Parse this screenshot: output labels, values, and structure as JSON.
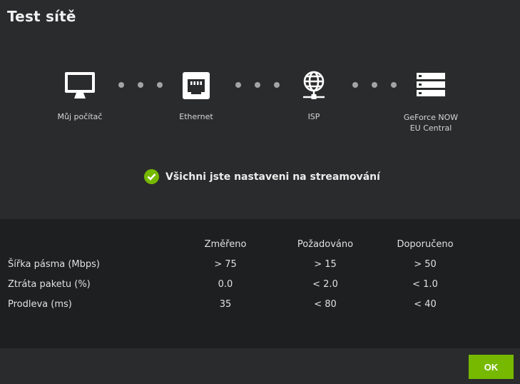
{
  "dialog": {
    "title": "Test sítě"
  },
  "path": {
    "nodes": [
      {
        "label": "Můj počítač",
        "label2": "",
        "icon": "monitor-icon"
      },
      {
        "label": "Ethernet",
        "label2": "",
        "icon": "ethernet-port-icon"
      },
      {
        "label": "ISP",
        "label2": "",
        "icon": "globe-network-icon"
      },
      {
        "label": "GeForce NOW",
        "label2": "EU Central",
        "icon": "server-rack-icon"
      }
    ]
  },
  "status": {
    "text": "Všichni jste nastaveni na streamování",
    "icon": "check-circle-icon",
    "color": "#76b900"
  },
  "results": {
    "headers": [
      "Změřeno",
      "Požadováno",
      "Doporučeno"
    ],
    "rows": [
      {
        "label": "Šířka pásma (Mbps)",
        "values": [
          "> 75",
          "> 15",
          "> 50"
        ]
      },
      {
        "label": "Ztráta paketu (%)",
        "values": [
          "0.0",
          "< 2.0",
          "< 1.0"
        ]
      },
      {
        "label": "Prodleva (ms)",
        "values": [
          "35",
          "< 80",
          "< 40"
        ]
      }
    ]
  },
  "footer": {
    "ok_label": "OK"
  },
  "colors": {
    "accent": "#76b900",
    "panel": "#2a2b2c",
    "table_bg": "#1e1f20"
  }
}
